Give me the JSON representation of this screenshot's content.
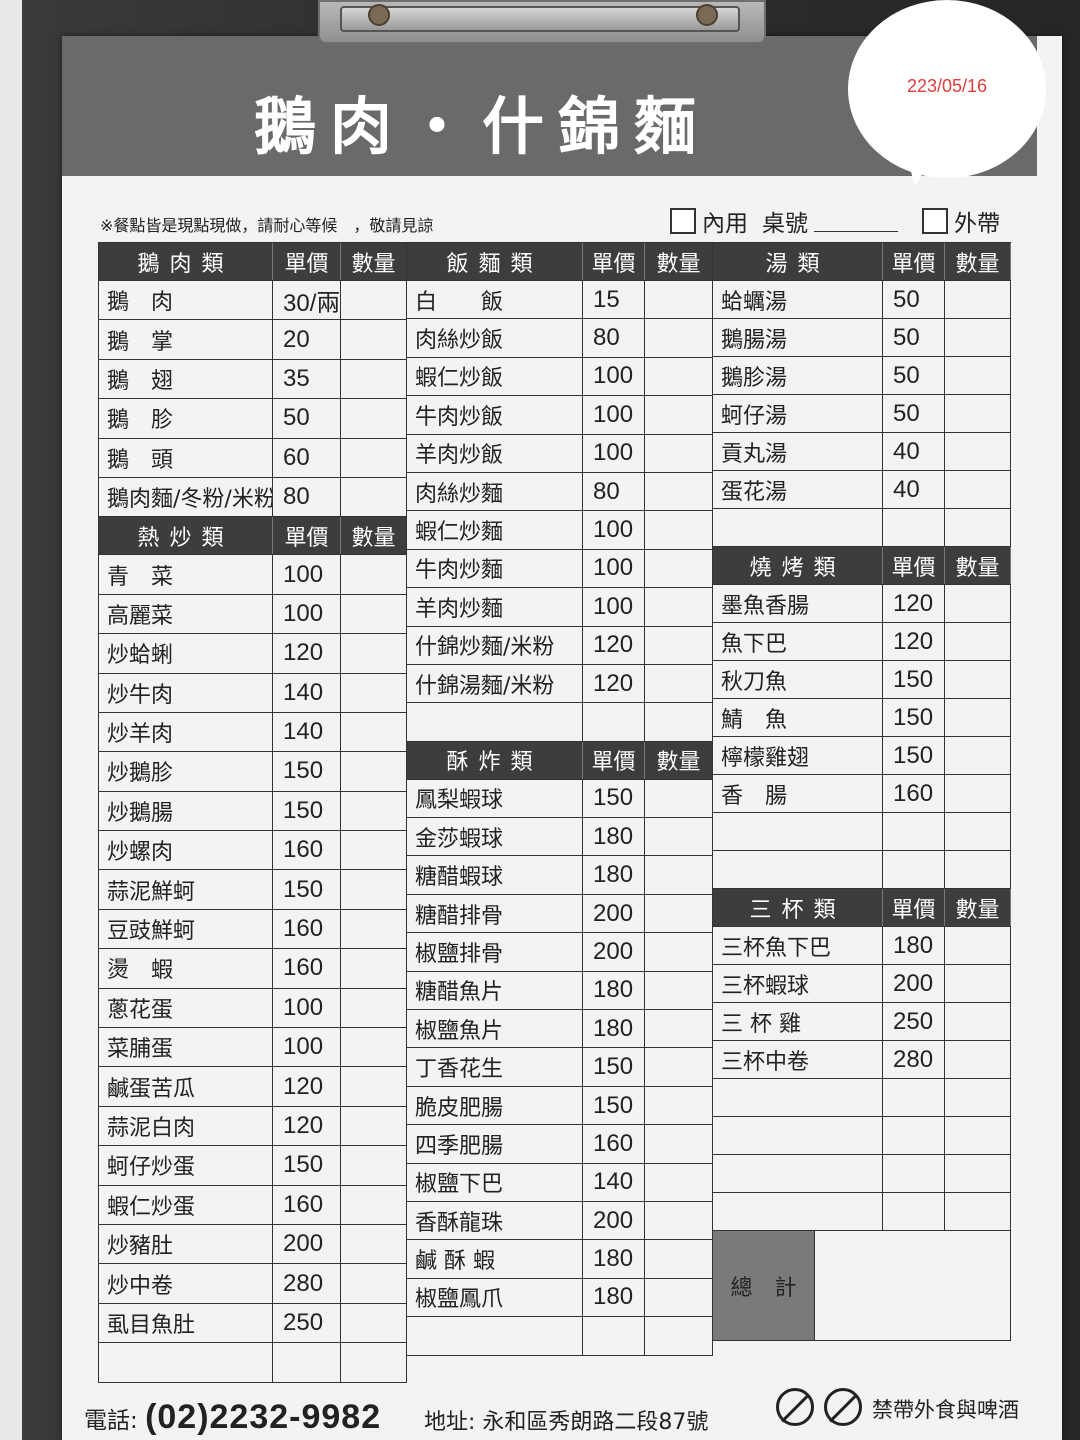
{
  "title": "鵝肉・什錦麵",
  "bubble_text": "223/05/16",
  "note": "※餐點皆是現點現做，請耐心等候　，敬請見諒",
  "dine_in": "內用",
  "table_no": "桌號",
  "takeout": "外帶",
  "col1": {
    "sections": [
      {
        "title": "鵝肉類",
        "price_label": "單價",
        "qty_label": "數量",
        "items": [
          [
            "鵝　肉",
            "30/兩"
          ],
          [
            "鵝　掌",
            "20"
          ],
          [
            "鵝　翅",
            "35"
          ],
          [
            "鵝　胗",
            "50"
          ],
          [
            "鵝　頭",
            "60"
          ],
          [
            "鵝肉麵/冬粉/米粉",
            "80"
          ]
        ]
      },
      {
        "title": "熱炒類",
        "price_label": "單價",
        "qty_label": "數量",
        "items": [
          [
            "青　菜",
            "100"
          ],
          [
            "高麗菜",
            "100"
          ],
          [
            "炒蛤蜊",
            "120"
          ],
          [
            "炒牛肉",
            "140"
          ],
          [
            "炒羊肉",
            "140"
          ],
          [
            "炒鵝胗",
            "150"
          ],
          [
            "炒鵝腸",
            "150"
          ],
          [
            "炒螺肉",
            "160"
          ],
          [
            "蒜泥鮮蚵",
            "150"
          ],
          [
            "豆豉鮮蚵",
            "160"
          ],
          [
            "燙　蝦",
            "160"
          ],
          [
            "蔥花蛋",
            "100"
          ],
          [
            "菜脯蛋",
            "100"
          ],
          [
            "鹹蛋苦瓜",
            "120"
          ],
          [
            "蒜泥白肉",
            "120"
          ],
          [
            "蚵仔炒蛋",
            "150"
          ],
          [
            "蝦仁炒蛋",
            "160"
          ],
          [
            "炒豬肚",
            "200"
          ],
          [
            "炒中卷",
            "280"
          ],
          [
            "虱目魚肚",
            "250"
          ],
          [
            "",
            ""
          ]
        ]
      }
    ]
  },
  "col2": {
    "sections": [
      {
        "title": "飯麵類",
        "price_label": "單價",
        "qty_label": "數量",
        "items": [
          [
            "白　　飯",
            "15"
          ],
          [
            "肉絲炒飯",
            "80"
          ],
          [
            "蝦仁炒飯",
            "100"
          ],
          [
            "牛肉炒飯",
            "100"
          ],
          [
            "羊肉炒飯",
            "100"
          ],
          [
            "肉絲炒麵",
            "80"
          ],
          [
            "蝦仁炒麵",
            "100"
          ],
          [
            "牛肉炒麵",
            "100"
          ],
          [
            "羊肉炒麵",
            "100"
          ],
          [
            "什錦炒麵/米粉",
            "120"
          ],
          [
            "什錦湯麵/米粉",
            "120"
          ],
          [
            "",
            ""
          ]
        ]
      },
      {
        "title": "酥炸類",
        "price_label": "單價",
        "qty_label": "數量",
        "items": [
          [
            "鳳梨蝦球",
            "150"
          ],
          [
            "金莎蝦球",
            "180"
          ],
          [
            "糖醋蝦球",
            "180"
          ],
          [
            "糖醋排骨",
            "200"
          ],
          [
            "椒鹽排骨",
            "200"
          ],
          [
            "糖醋魚片",
            "180"
          ],
          [
            "椒鹽魚片",
            "180"
          ],
          [
            "丁香花生",
            "150"
          ],
          [
            "脆皮肥腸",
            "150"
          ],
          [
            "四季肥腸",
            "160"
          ],
          [
            "椒鹽下巴",
            "140"
          ],
          [
            "香酥龍珠",
            "200"
          ],
          [
            "鹹 酥 蝦",
            "180"
          ],
          [
            "椒鹽鳳爪",
            "180"
          ],
          [
            "",
            ""
          ]
        ]
      }
    ]
  },
  "col3": {
    "sections": [
      {
        "title": "湯類",
        "price_label": "單價",
        "qty_label": "數量",
        "items": [
          [
            "蛤蠣湯",
            "50"
          ],
          [
            "鵝腸湯",
            "50"
          ],
          [
            "鵝胗湯",
            "50"
          ],
          [
            "蚵仔湯",
            "50"
          ],
          [
            "貢丸湯",
            "40"
          ],
          [
            "蛋花湯",
            "40"
          ],
          [
            "",
            ""
          ]
        ]
      },
      {
        "title": "燒烤類",
        "price_label": "單價",
        "qty_label": "數量",
        "items": [
          [
            "墨魚香腸",
            "120"
          ],
          [
            "魚下巴",
            "120"
          ],
          [
            "秋刀魚",
            "150"
          ],
          [
            "鯖　魚",
            "150"
          ],
          [
            "檸檬雞翅",
            "150"
          ],
          [
            "香　腸",
            "160"
          ],
          [
            "",
            ""
          ],
          [
            "",
            ""
          ]
        ]
      },
      {
        "title": "三杯類",
        "price_label": "單價",
        "qty_label": "數量",
        "items": [
          [
            "三杯魚下巴",
            "180"
          ],
          [
            "三杯蝦球",
            "200"
          ],
          [
            "三 杯 雞",
            "250"
          ],
          [
            "三杯中卷",
            "280"
          ],
          [
            "",
            ""
          ],
          [
            "",
            ""
          ],
          [
            "",
            ""
          ],
          [
            "",
            ""
          ]
        ]
      }
    ],
    "total_label": "總　計"
  },
  "footer": {
    "phone_label": "電話:",
    "phone": "(02)2232-9982",
    "address": "地址: 永和區秀朗路二段87號",
    "notice": "禁帶外食與啤酒"
  }
}
